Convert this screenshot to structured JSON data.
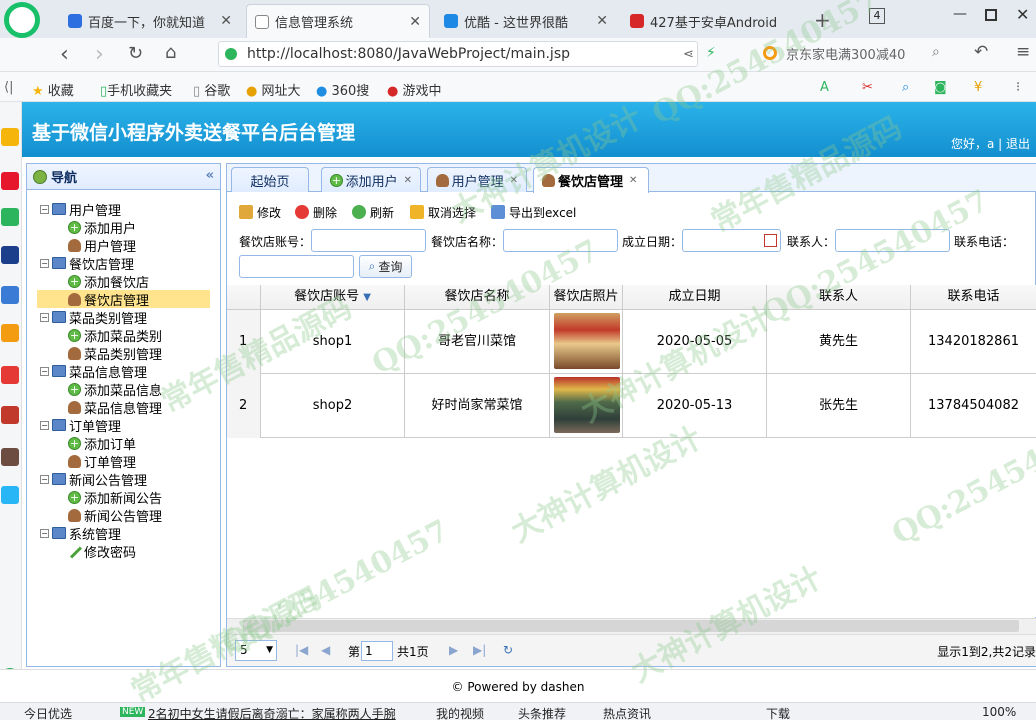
{
  "browser": {
    "tabs": [
      {
        "label": "百度一下，你就知道"
      },
      {
        "label": "信息管理系统"
      },
      {
        "label": "优酷 - 这世界很酷"
      },
      {
        "label": "427基于安卓Android"
      }
    ],
    "tab_count": "4",
    "url": "http://localhost:8080/JavaWebProject/main.jsp",
    "search_placeholder": "京东家电满300减40",
    "bookmarks": [
      "收藏",
      "手机收藏夹",
      "谷歌",
      "网址大",
      "360搜",
      "游戏中"
    ]
  },
  "app": {
    "title": "基于微信小程序外卖送餐平台后台管理",
    "greeting": "您好，a | 退出"
  },
  "nav": {
    "title": "导航",
    "tree": [
      {
        "label": "用户管理",
        "children": [
          "添加用户",
          "用户管理"
        ]
      },
      {
        "label": "餐饮店管理",
        "children": [
          "添加餐饮店",
          "餐饮店管理"
        ]
      },
      {
        "label": "菜品类别管理",
        "children": [
          "添加菜品类别",
          "菜品类别管理"
        ]
      },
      {
        "label": "菜品信息管理",
        "children": [
          "添加菜品信息",
          "菜品信息管理"
        ]
      },
      {
        "label": "订单管理",
        "children": [
          "添加订单",
          "订单管理"
        ]
      },
      {
        "label": "新闻公告管理",
        "children": [
          "添加新闻公告",
          "新闻公告管理"
        ]
      },
      {
        "label": "系统管理",
        "children": [
          "修改密码"
        ]
      }
    ],
    "selected": "餐饮店管理"
  },
  "content_tabs": [
    "起始页",
    "添加用户",
    "用户管理",
    "餐饮店管理"
  ],
  "toolbar": [
    "修改",
    "删除",
    "刷新",
    "取消选择",
    "导出到excel"
  ],
  "search": {
    "fields": [
      "餐饮店账号：",
      "餐饮店名称：",
      "成立日期：",
      "联系人：",
      "联系电话："
    ],
    "query_label": "查询"
  },
  "grid": {
    "columns": [
      "餐饮店账号",
      "餐饮店名称",
      "餐饮店照片",
      "成立日期",
      "联系人",
      "联系电话"
    ],
    "rows": [
      {
        "num": "1",
        "account": "shop1",
        "name": "哥老官川菜馆",
        "date": "2020-05-05",
        "contact": "黄先生",
        "phone": "13420182861"
      },
      {
        "num": "2",
        "account": "shop2",
        "name": "好时尚家常菜馆",
        "date": "2020-05-13",
        "contact": "张先生",
        "phone": "13784504082"
      }
    ]
  },
  "pager": {
    "page_size": "5",
    "page_prefix": "第",
    "page_value": "1",
    "page_total": "共1页",
    "summary": "显示1到2,共2记录"
  },
  "footer": {
    "powered": "© Powered by dashen"
  },
  "statusbar": [
    "今日优选",
    "2名初中女生请假后离奇溺亡：家属称两人手腕",
    "我的视频",
    "头条推荐",
    "热点资讯",
    "下载",
    "100%"
  ],
  "watermarks": [
    "QQ:254540457",
    "大神计算机设计",
    "常年售精品源码"
  ]
}
